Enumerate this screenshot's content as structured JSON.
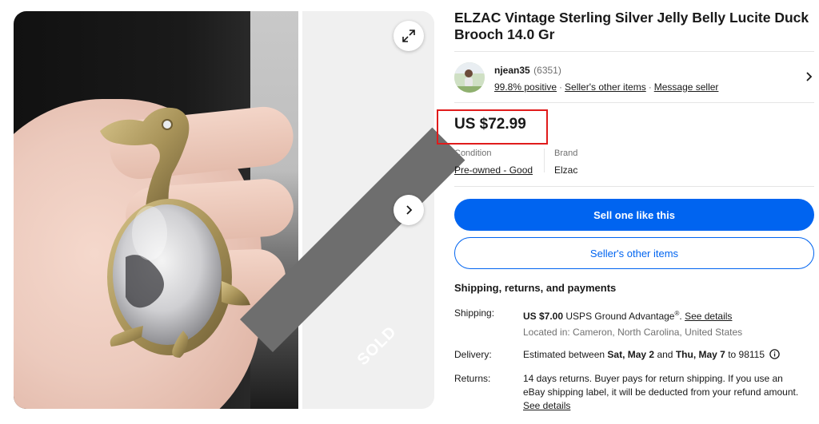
{
  "listing": {
    "title": "ELZAC Vintage Sterling Silver Jelly Belly Lucite Duck Brooch 14.0 Gr",
    "sold_label": "SOLD",
    "icons": {
      "expand": "expand-icon",
      "next": "chevron-right-icon",
      "seller_chevron": "chevron-right-icon",
      "info": "info-icon"
    }
  },
  "seller": {
    "name": "njean35",
    "feedback_count": "(6351)",
    "positive": "99.8% positive",
    "other_items": "Seller's other items",
    "message": "Message seller"
  },
  "price": {
    "value": "US $72.99",
    "highlight_color": "#e01b1b"
  },
  "condition": {
    "label": "Condition",
    "value": "Pre-owned - Good"
  },
  "brand": {
    "label": "Brand",
    "value": "Elzac"
  },
  "actions": {
    "sell_one": "Sell one like this",
    "sellers_other_items": "Seller's other items",
    "primary_color": "#0064f0"
  },
  "shipping": {
    "section_title": "Shipping, returns, and payments",
    "shipping_label": "Shipping:",
    "shipping_cost": "US $7.00",
    "shipping_service": "USPS Ground Advantage",
    "shipping_mark": "®",
    "see_details": "See details",
    "located_in": "Located in: Cameron, North Carolina, United States",
    "delivery_label": "Delivery:",
    "delivery_prefix": "Estimated between",
    "delivery_start": "Sat, May 2",
    "delivery_and": "and",
    "delivery_end": "Thu, May 7",
    "delivery_to": "to 98115",
    "returns_label": "Returns:",
    "returns_text": "14 days returns. Buyer pays for return shipping. If you use an eBay shipping label, it will be deducted from your refund amount.",
    "returns_link": "See details"
  }
}
